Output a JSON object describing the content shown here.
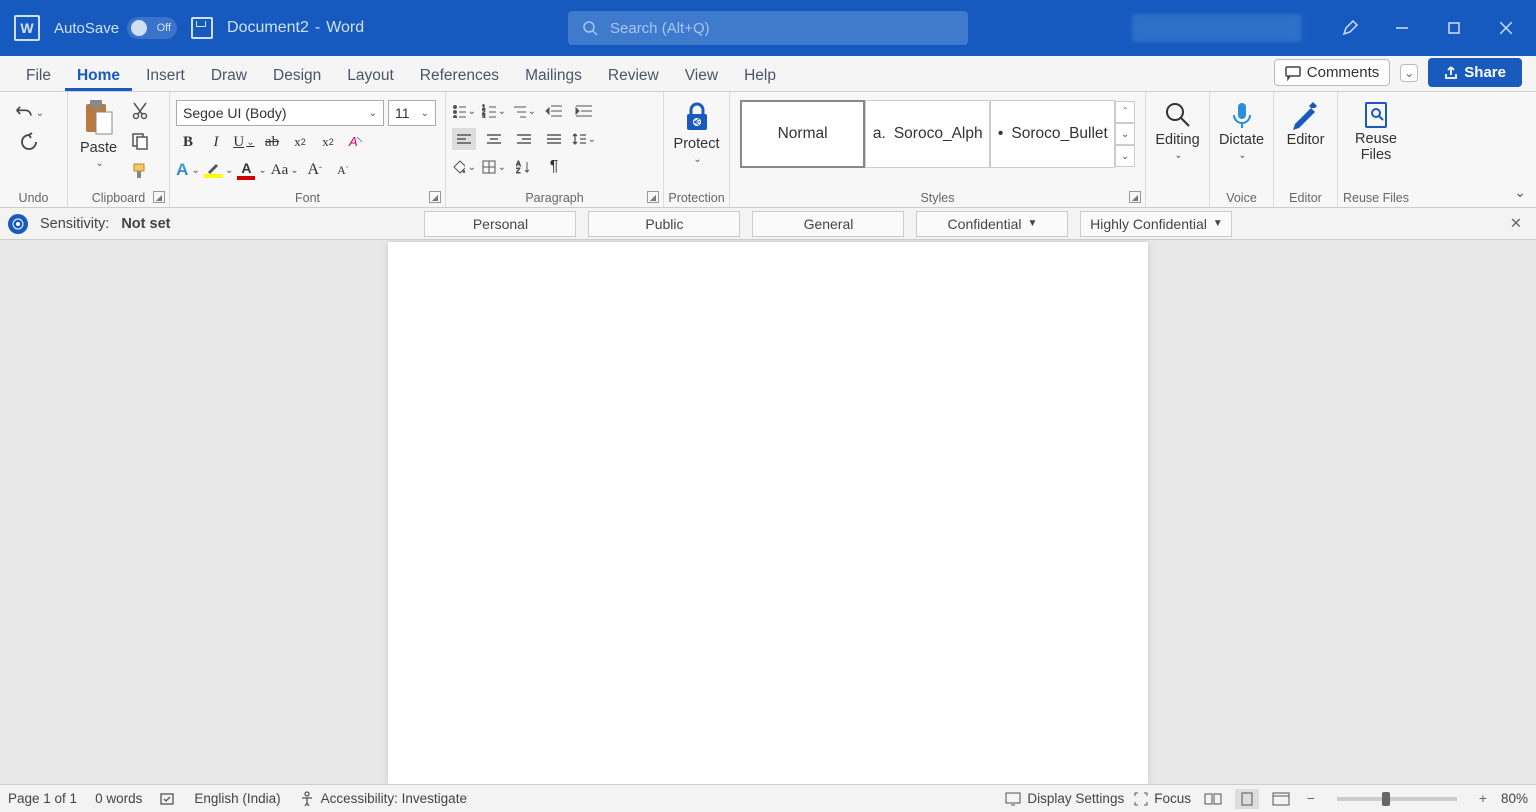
{
  "title_bar": {
    "autosave_label": "AutoSave",
    "autosave_state": "Off",
    "doc_name": "Document2",
    "app_name": "Word",
    "search_placeholder": "Search (Alt+Q)"
  },
  "menu": {
    "items": [
      "File",
      "Home",
      "Insert",
      "Draw",
      "Design",
      "Layout",
      "References",
      "Mailings",
      "Review",
      "View",
      "Help"
    ],
    "active": "Home",
    "comments": "Comments",
    "share": "Share"
  },
  "ribbon": {
    "undo_label": "Undo",
    "clipboard_label": "Clipboard",
    "paste_label": "Paste",
    "font_label": "Font",
    "font_name": "Segoe UI (Body)",
    "font_size": "11",
    "paragraph_label": "Paragraph",
    "protect_label": "Protect",
    "protection_label": "Protection",
    "styles_label": "Styles",
    "styles": [
      "Normal",
      "Soroco_Alph",
      "Soroco_Bullet"
    ],
    "style_prefixes": [
      "",
      "a.",
      "•"
    ],
    "editing_label": "Editing",
    "dictate_label": "Dictate",
    "voice_label": "Voice",
    "editor_label": "Editor",
    "reuse_label": "Reuse Files",
    "reuse_group": "Reuse Files"
  },
  "sensitivity": {
    "label": "Sensitivity:",
    "value": "Not set",
    "options": [
      "Personal",
      "Public",
      "General",
      "Confidential",
      "Highly Confidential"
    ]
  },
  "status": {
    "page": "Page 1 of 1",
    "words": "0 words",
    "language": "English (India)",
    "accessibility": "Accessibility: Investigate",
    "display_settings": "Display Settings",
    "focus": "Focus",
    "zoom": "80%"
  }
}
